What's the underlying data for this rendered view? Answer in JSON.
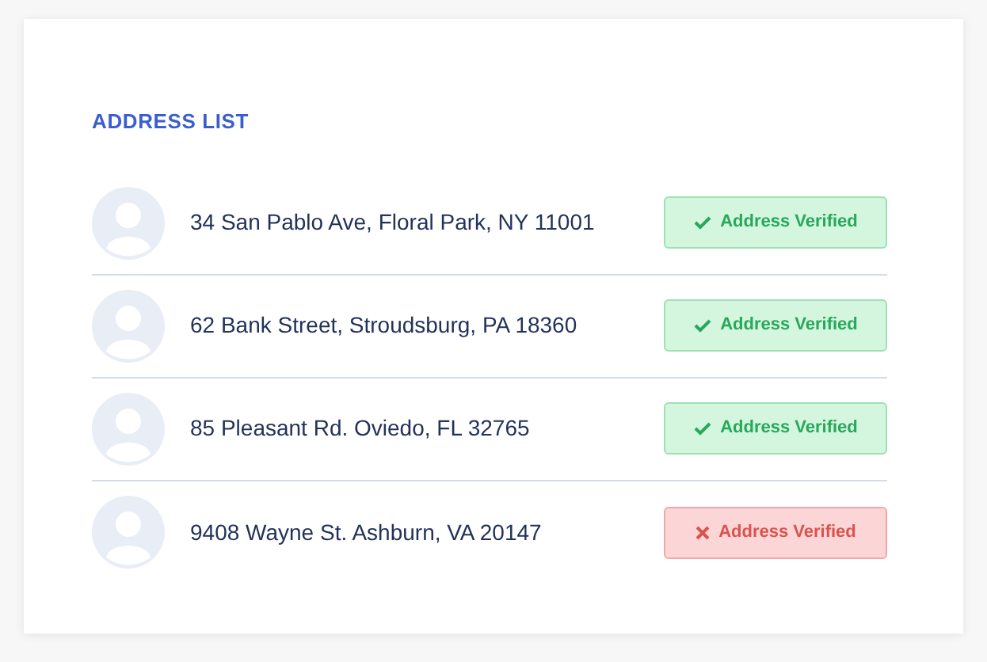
{
  "title": "ADDRESS LIST",
  "addresses": [
    {
      "address": "34 San Pablo Ave, Floral Park, NY 11001",
      "verified": true,
      "badge": "Address Verified"
    },
    {
      "address": "62 Bank Street, Stroudsburg, PA 18360",
      "verified": true,
      "badge": "Address Verified"
    },
    {
      "address": "85 Pleasant Rd. Oviedo, FL 32765",
      "verified": true,
      "badge": "Address Verified"
    },
    {
      "address": "9408 Wayne St. Ashburn, VA 20147",
      "verified": false,
      "badge": "Address Verified"
    }
  ]
}
